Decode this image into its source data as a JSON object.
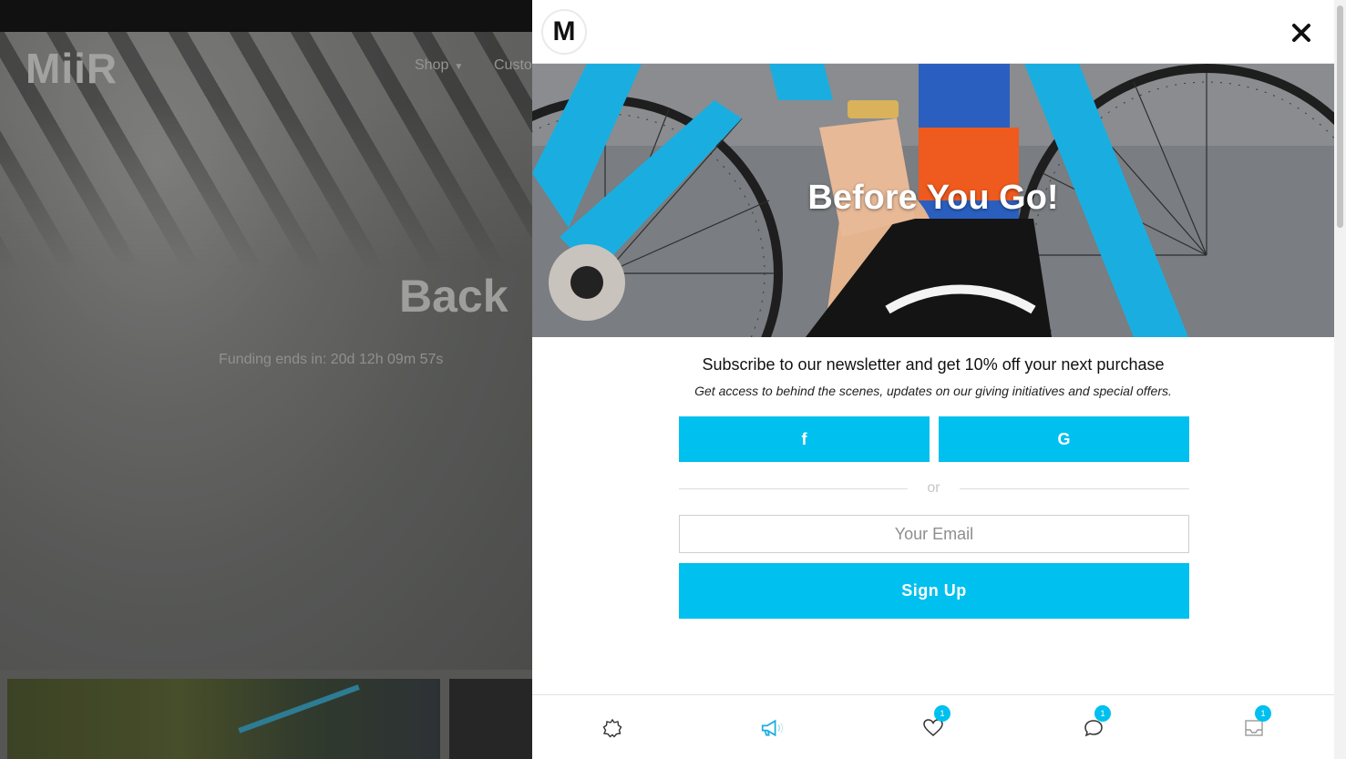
{
  "site": {
    "logo": "MiiR",
    "nav": {
      "shop": "Shop",
      "custom": "Custo"
    },
    "hero_title": "Back",
    "funding_text": "Funding ends in: 20d 12h 09m 57s"
  },
  "modal": {
    "brand_letter": "M",
    "close_icon": "close-icon",
    "title": "Before You Go!",
    "headline": "Subscribe to our newsletter and get 10% off your next purchase",
    "subline": "Get access to behind the scenes, updates on our giving initiatives and special offers.",
    "facebook_label": "f",
    "google_label": "G",
    "divider_text": "or",
    "email_placeholder": "Your Email",
    "signup_label": "Sign Up",
    "accent_color": "#00c0ef"
  },
  "bottom_tabs": [
    {
      "icon": "settings-icon",
      "badge": ""
    },
    {
      "icon": "megaphone-icon",
      "badge": ""
    },
    {
      "icon": "heart-icon",
      "badge": "1"
    },
    {
      "icon": "chat-icon",
      "badge": "1"
    },
    {
      "icon": "inbox-icon",
      "badge": "1"
    }
  ]
}
